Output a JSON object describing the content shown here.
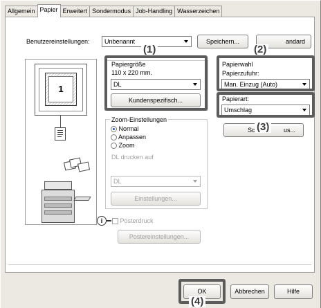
{
  "tabs": [
    "Allgemein",
    "Papier",
    "Erweitert",
    "Sondermodus",
    "Job-Handling",
    "Wasserzeichen"
  ],
  "active_tab": "Papier",
  "user_settings": {
    "label": "Benutzereinstellungen:",
    "value": "Unbenannt",
    "save_label": "Speichern...",
    "standard_label": "andard"
  },
  "paper_size": {
    "title": "Papiergröße",
    "dims": "110 x 220 mm.",
    "value": "DL",
    "custom_button": "Kundenspezifisch..."
  },
  "paper_select": {
    "title": "Papierwahl",
    "tray_label": "Papierzufuhr:",
    "tray_value": "Man. Einzug (Auto)"
  },
  "paper_type": {
    "label": "Papierart:",
    "value": "Umschlag",
    "button_visible": "Sch",
    "button_tail": "us..."
  },
  "zoom": {
    "title": "Zoom-Einstellungen",
    "options": [
      "Normal",
      "Anpassen",
      "Zoom"
    ],
    "selected": "Normal",
    "print_on_label": "DL drucken auf",
    "print_on_value": "DL",
    "settings_button": "Einstellungen..."
  },
  "poster": {
    "checkbox_label": "Posterdruck",
    "settings_button": "Postereinstellungen..."
  },
  "preview": {
    "page_number": "1"
  },
  "callouts": [
    "(1)",
    "(2)",
    "(3)",
    "(4)"
  ],
  "footer": {
    "ok": "OK",
    "cancel": "Abbrechen",
    "help": "Hilfe"
  }
}
